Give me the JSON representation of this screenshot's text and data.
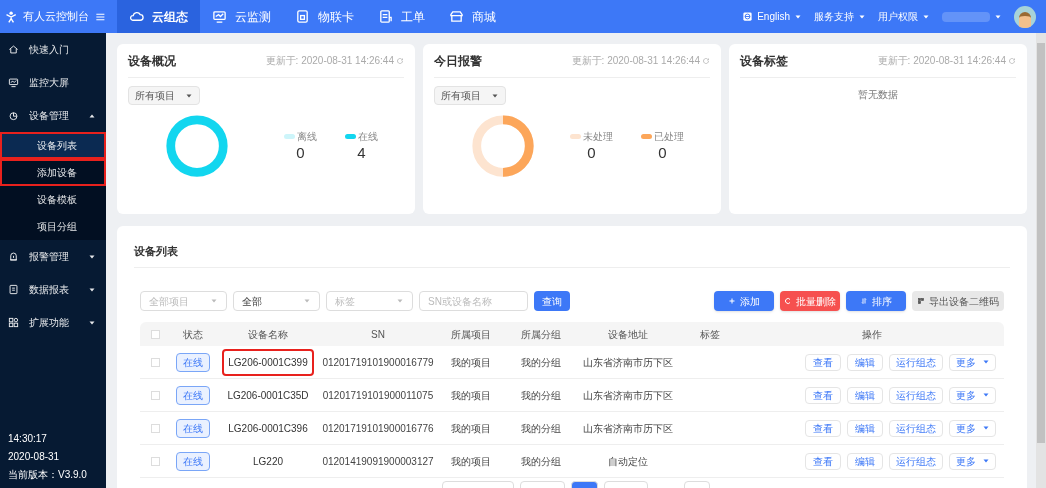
{
  "topbar": {
    "brand": "有人云控制台",
    "nav": [
      {
        "label": "云组态",
        "selected": true
      },
      {
        "label": "云监测",
        "selected": false
      },
      {
        "label": "物联卡",
        "selected": false
      },
      {
        "label": "工单",
        "selected": false
      },
      {
        "label": "商城",
        "selected": false
      }
    ],
    "right": [
      {
        "label": "English"
      },
      {
        "label": "服务支持"
      },
      {
        "label": "用户权限"
      }
    ]
  },
  "sidebar": {
    "items": [
      {
        "label": "快速入门",
        "kind": "link",
        "selected": false
      },
      {
        "label": "监控大屏",
        "kind": "link",
        "selected": false
      },
      {
        "label": "设备管理",
        "kind": "group",
        "expanded": true,
        "selected": false,
        "children": [
          {
            "label": "设备列表",
            "selected": true,
            "highlighted": true
          },
          {
            "label": "添加设备",
            "selected": false,
            "highlighted": true
          },
          {
            "label": "设备模板",
            "selected": false,
            "highlighted": false
          },
          {
            "label": "项目分组",
            "selected": false,
            "highlighted": false
          }
        ]
      },
      {
        "label": "报警管理",
        "kind": "group",
        "expanded": false,
        "selected": false
      },
      {
        "label": "数据报表",
        "kind": "group",
        "expanded": false,
        "selected": false
      },
      {
        "label": "扩展功能",
        "kind": "group",
        "expanded": false,
        "selected": false
      }
    ],
    "footer": [
      "14:30:17",
      "2020-08-31",
      "当前版本：V3.9.0"
    ]
  },
  "cards": [
    {
      "title": "设备概况",
      "updated": "更新于: 2020-08-31 14:26:44",
      "kind": "donut",
      "select": "所有项目",
      "legend": [
        {
          "label": "离线",
          "value": "0",
          "color": "#cdf5fa"
        },
        {
          "label": "在线",
          "value": "4",
          "color": "#12d6ef"
        }
      ]
    },
    {
      "title": "今日报警",
      "updated": "更新于: 2020-08-31 14:26:44",
      "kind": "donut",
      "select": "所有项目",
      "legend": [
        {
          "label": "未处理",
          "value": "0",
          "color": "#fde4d0"
        },
        {
          "label": "已处理",
          "value": "0",
          "color": "#fca65a"
        }
      ]
    },
    {
      "title": "设备标签",
      "updated": "更新于: 2020-08-31 14:26:44",
      "kind": "empty",
      "empty": "暂无数据"
    }
  ],
  "device_list": {
    "title": "设备列表",
    "select_all_checked": false,
    "filters": [
      {
        "placeholder": "全部项目",
        "kind": "select"
      },
      {
        "value": "全部",
        "kind": "select"
      },
      {
        "placeholder": "标签",
        "kind": "select"
      },
      {
        "placeholder": "SN或设备名称",
        "kind": "input"
      }
    ],
    "query": "查询",
    "actions": [
      {
        "label": "添加",
        "kind": "primary",
        "disabled": false
      },
      {
        "label": "批量删除",
        "kind": "danger",
        "disabled": false
      },
      {
        "label": "排序",
        "kind": "primary",
        "disabled": false
      },
      {
        "label": "导出设备二维码",
        "kind": "plain",
        "disabled": true
      }
    ],
    "columns": [
      "状态",
      "设备名称",
      "SN",
      "所属项目",
      "所属分组",
      "设备地址",
      "标签",
      "操作"
    ],
    "rows": [
      {
        "checked": false,
        "status": "在线",
        "name": "LG206-0001C399",
        "highlighted": true,
        "sn": "01201719101900016779",
        "project": "我的项目",
        "group": "我的分组",
        "address": "山东省济南市历下区",
        "ops": [
          "查看",
          "编辑",
          "运行组态",
          "更多"
        ]
      },
      {
        "checked": false,
        "status": "在线",
        "name": "LG206-0001C35D",
        "highlighted": false,
        "sn": "01201719101900011075",
        "project": "我的项目",
        "group": "我的分组",
        "address": "山东省济南市历下区",
        "ops": [
          "查看",
          "编辑",
          "运行组态",
          "更多"
        ]
      },
      {
        "checked": false,
        "status": "在线",
        "name": "LG206-0001C396",
        "highlighted": false,
        "sn": "01201719101900016776",
        "project": "我的项目",
        "group": "我的分组",
        "address": "山东省济南市历下区",
        "ops": [
          "查看",
          "编辑",
          "运行组态",
          "更多"
        ]
      },
      {
        "checked": false,
        "status": "在线",
        "name": "LG220",
        "highlighted": false,
        "sn": "01201419091900003127",
        "project": "我的项目",
        "group": "我的分组",
        "address": "自动定位",
        "ops": [
          "查看",
          "编辑",
          "运行组态",
          "更多"
        ]
      }
    ]
  }
}
